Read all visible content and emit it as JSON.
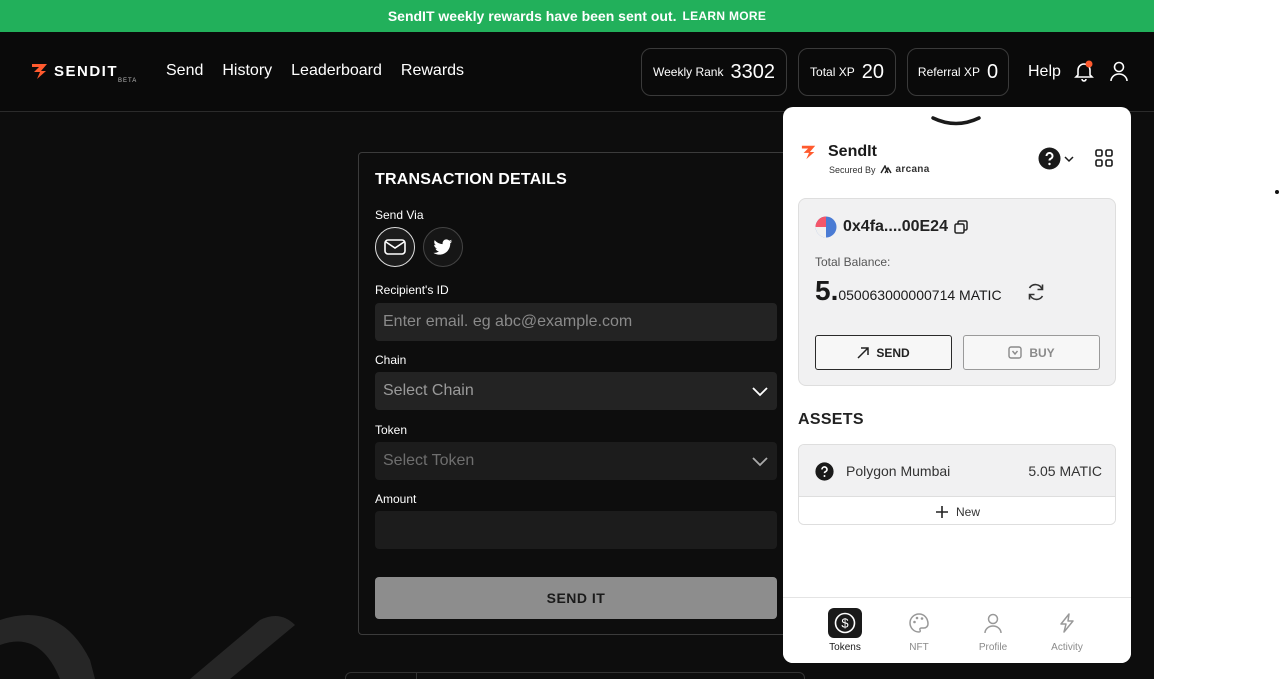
{
  "banner": {
    "message": "SendIT weekly rewards have been sent out.",
    "link": "LEARN MORE",
    "color": "#22b05b"
  },
  "brand": {
    "name": "SENDIT",
    "tag": "BETA",
    "accent": "#ff5a2e"
  },
  "nav": {
    "links": [
      "Send",
      "History",
      "Leaderboard",
      "Rewards"
    ],
    "help": "Help"
  },
  "stats": {
    "weekly_rank": {
      "label": "Weekly Rank",
      "value": "3302"
    },
    "total_xp": {
      "label": "Total XP",
      "value": "20"
    },
    "referral_xp": {
      "label": "Referral XP",
      "value": "0"
    }
  },
  "transaction": {
    "title": "TRANSACTION DETAILS",
    "send_via_label": "Send Via",
    "recipient_label": "Recipient's ID",
    "recipient_placeholder": "Enter email. eg abc@example.com",
    "chain_label": "Chain",
    "chain_value": "Select Chain",
    "token_label": "Token",
    "token_value": "Select Token",
    "amount_label": "Amount",
    "amount_value": "",
    "submit_label": "SEND IT"
  },
  "wallet": {
    "app_name": "SendIt",
    "secured_by": "Secured By",
    "provider": "arcana",
    "address": "0x4fa....00E24",
    "balance_label": "Total Balance:",
    "balance_int": "5.",
    "balance_frac": "050063000000714 MATIC",
    "send_label": "SEND",
    "buy_label": "BUY",
    "assets_heading": "ASSETS",
    "assets": [
      {
        "name": "Polygon Mumbai",
        "value": "5.05 MATIC"
      }
    ],
    "new_label": "New",
    "tabs": [
      "Tokens",
      "NFT",
      "Profile",
      "Activity"
    ],
    "active_tab": "Tokens"
  }
}
